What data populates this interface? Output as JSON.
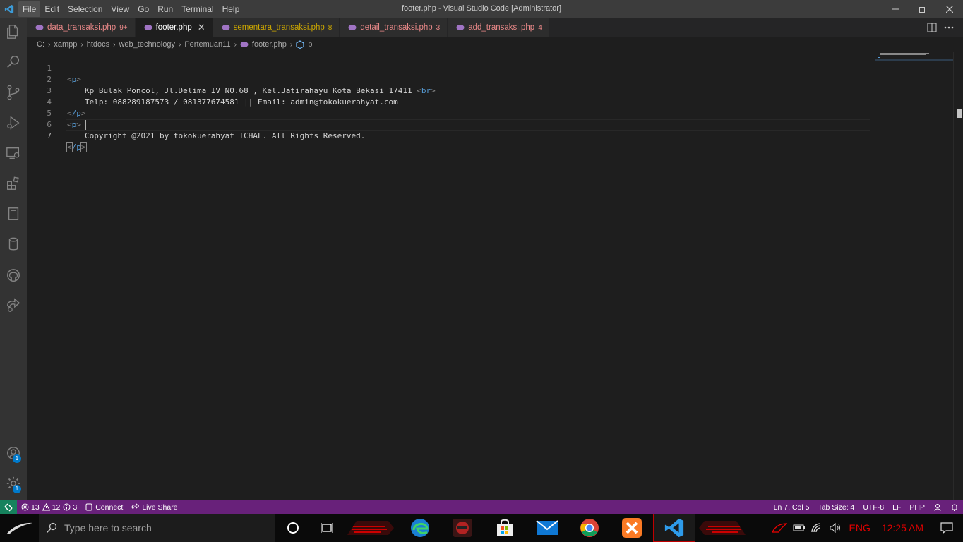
{
  "titlebar": {
    "menu": [
      "File",
      "Edit",
      "Selection",
      "View",
      "Go",
      "Run",
      "Terminal",
      "Help"
    ],
    "window_title": "footer.php - Visual Studio Code [Administrator]"
  },
  "tabs": [
    {
      "label": "data_transaksi.php",
      "count": "9+"
    },
    {
      "label": "footer.php",
      "count": ""
    },
    {
      "label": "sementara_transaksi.php",
      "count": "8"
    },
    {
      "label": "detail_transaksi.php",
      "count": "3"
    },
    {
      "label": "add_transaksi.php",
      "count": "4"
    }
  ],
  "breadcrumb": [
    "C:",
    "xampp",
    "htdocs",
    "web_technology",
    "Pertemuan11",
    "footer.php",
    "p"
  ],
  "editor": {
    "line_numbers": [
      "1",
      "2",
      "3",
      "4",
      "5",
      "6",
      "7"
    ],
    "line1_tag": "p",
    "line2_text": "Kp Bulak Poncol, Jl.Delima IV NO.68 , Kel.Jatirahayu Kota Bekasi 17411 ",
    "line2_tag": "br",
    "line3_text": "Telp: 088289187573 / 081377674581 || Email: admin@tokokuerahyat.com",
    "line4_tag": "/p",
    "line5_tag": "p",
    "line6_text": "Copyright @2021 by tokokuerahyat_ICHAL. All Rights Reserved.",
    "line7_tag": "/p"
  },
  "activity_badges": {
    "accounts": "1",
    "settings": "1"
  },
  "statusbar": {
    "errors": "13",
    "warnings": "12",
    "infos": "3",
    "connect": "Connect",
    "live_share": "Live Share",
    "position": "Ln 7, Col 5",
    "tab_size": "Tab Size: 4",
    "encoding": "UTF-8",
    "eol": "LF",
    "language": "PHP"
  },
  "taskbar": {
    "search_placeholder": "Type here to search",
    "language": "ENG",
    "time": "12:25 AM"
  },
  "colors": {
    "statusbar": "#68217a",
    "accent": "#007acc",
    "remote": "#16825d",
    "tray_red": "#e00000"
  }
}
